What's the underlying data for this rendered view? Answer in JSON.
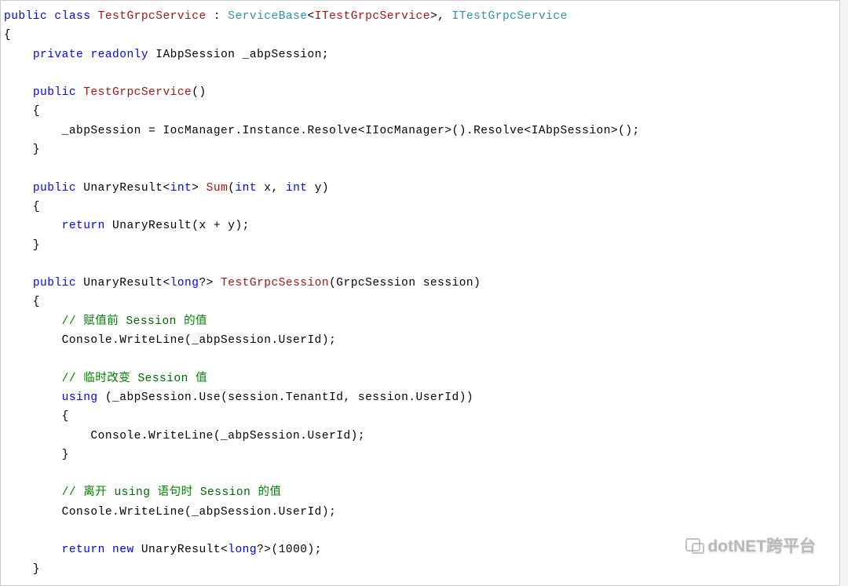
{
  "code": {
    "l1": {
      "kw_public": "public",
      "kw_class": "class",
      "className": "TestGrpcService",
      "colon": " : ",
      "base": "ServiceBase",
      "lt": "<",
      "baseArg": "ITestGrpcService",
      "gt": ">",
      "comma": ", ",
      "iface": "ITestGrpcService"
    },
    "l2": "{",
    "l3": {
      "kw_private": "private",
      "kw_readonly": "readonly",
      "rest": "IAbpSession _abpSession;"
    },
    "l5": {
      "kw_public": "public",
      "ctor": "TestGrpcService",
      "parens": "()"
    },
    "l6": "    {",
    "l7": "        _abpSession = IocManager.Instance.Resolve<IIocManager>().Resolve<IAbpSession>();",
    "l8": "    }",
    "l10": {
      "kw_public": "public",
      "ret": "UnaryResult<",
      "typeArg": "int",
      "close": "> ",
      "method": "Sum",
      "open": "(",
      "p1t": "int",
      "p1": " x, ",
      "p2t": "int",
      "p2": " y)"
    },
    "l11": "    {",
    "l12": {
      "kw_return": "return",
      "rest": " UnaryResult(x + y);"
    },
    "l13": "    }",
    "l15": {
      "kw_public": "public",
      "ret": "UnaryResult<",
      "typeArg": "long",
      "q": "?",
      "close": "> ",
      "method": "TestGrpcSession",
      "params": "(GrpcSession session)"
    },
    "l16": "    {",
    "l17": {
      "slashes": "// ",
      "c1": "赋值前 ",
      "sess": "Session ",
      "c2": "的值"
    },
    "l18": "        Console.WriteLine(_abpSession.UserId);",
    "l20": {
      "slashes": "// ",
      "c1": "临时改变 ",
      "sess": "Session ",
      "c2": "值"
    },
    "l21": {
      "kw_using": "using",
      "rest": " (_abpSession.Use(session.TenantId, session.UserId))"
    },
    "l22": "        {",
    "l23": "            Console.WriteLine(_abpSession.UserId);",
    "l24": "        }",
    "l26": {
      "slashes": "// ",
      "c1": "离开 ",
      "us": "using ",
      "c2": "语句时 ",
      "sess": "Session ",
      "c3": "的值"
    },
    "l27": "        Console.WriteLine(_abpSession.UserId);",
    "l29": {
      "kw_return": "return",
      "sp": " ",
      "kw_new": "new",
      "ret": " UnaryResult<",
      "typeArg": "long",
      "rest": "?>(1000);"
    },
    "l30": "    }"
  },
  "watermark": "dotNET跨平台"
}
